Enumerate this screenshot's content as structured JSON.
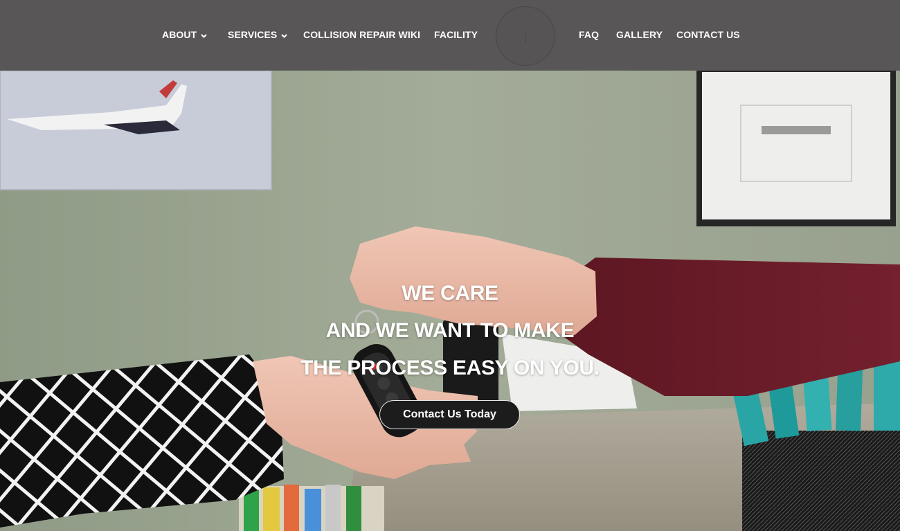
{
  "nav": {
    "about": "ABOUT",
    "services": "SERVICES",
    "wiki": "COLLISION REPAIR WIKI",
    "facility": "FACILITY",
    "faq": "FAQ",
    "gallery": "GALLERY",
    "contact": "CONTACT US",
    "dropdown_icon": "chevron-down"
  },
  "hero": {
    "line1": "WE CARE",
    "line2": "AND WE WANT TO MAKE",
    "line3": "THE PROCESS EASY ON YOU.",
    "cta_label": "Contact Us Today"
  },
  "colors": {
    "header_bg": "#595658",
    "button_bg": "#1c1c1c",
    "wall": "#9aa490",
    "sweater": "#6e1c2a"
  }
}
